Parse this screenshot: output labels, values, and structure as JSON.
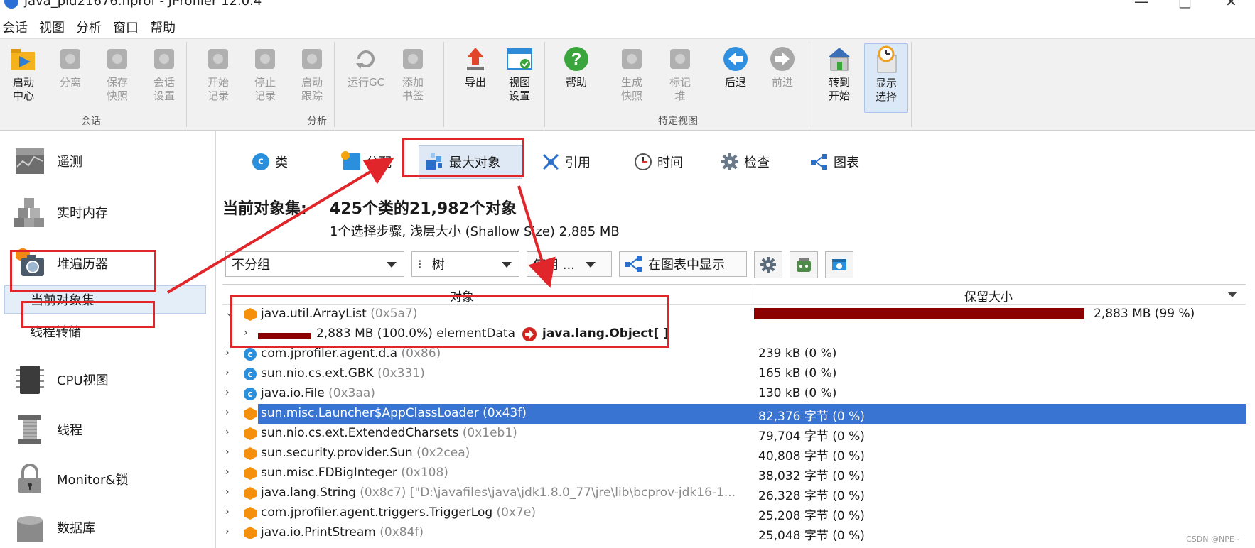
{
  "window": {
    "title": "java_pid21676.hprof - JProfiler 12.0.4"
  },
  "menu": [
    "会话",
    "视图",
    "分析",
    "窗口",
    "帮助"
  ],
  "toolbar": {
    "buttons": [
      {
        "line1": "启动",
        "line2": "中心",
        "icon": "session-start-icon",
        "enabled": true
      },
      {
        "line1": "分离",
        "line2": "",
        "icon": "detach-icon",
        "enabled": false
      },
      {
        "line1": "保存",
        "line2": "快照",
        "icon": "save-snapshot-icon",
        "enabled": false
      },
      {
        "line1": "会话",
        "line2": "设置",
        "icon": "session-settings-icon",
        "enabled": false
      },
      {
        "line1": "开始",
        "line2": "记录",
        "icon": "start-recording-icon",
        "enabled": false
      },
      {
        "line1": "停止",
        "line2": "记录",
        "icon": "stop-recording-icon",
        "enabled": false
      },
      {
        "line1": "启动",
        "line2": "跟踪",
        "icon": "start-tracking-icon",
        "enabled": false
      },
      {
        "line1": "运行GC",
        "line2": "",
        "icon": "run-gc-icon",
        "enabled": false
      },
      {
        "line1": "添加",
        "line2": "书签",
        "icon": "add-bookmark-icon",
        "enabled": false
      },
      {
        "line1": "导出",
        "line2": "",
        "icon": "export-icon",
        "enabled": true
      },
      {
        "line1": "视图",
        "line2": "设置",
        "icon": "view-settings-icon",
        "enabled": true
      },
      {
        "line1": "帮助",
        "line2": "",
        "icon": "help-icon",
        "enabled": true
      },
      {
        "line1": "生成",
        "line2": "快照",
        "icon": "take-snapshot-icon",
        "enabled": false
      },
      {
        "line1": "标记",
        "line2": "堆",
        "icon": "mark-heap-icon",
        "enabled": false
      },
      {
        "line1": "后退",
        "line2": "",
        "icon": "back-icon",
        "enabled": true
      },
      {
        "line1": "前进",
        "line2": "",
        "icon": "forward-icon",
        "enabled": false
      },
      {
        "line1": "转到",
        "line2": "开始",
        "icon": "go-home-icon",
        "enabled": true
      },
      {
        "line1": "显示",
        "line2": "选择",
        "icon": "show-selection-icon",
        "enabled": true
      }
    ],
    "groups": [
      "会话",
      "分析",
      "特定视图"
    ]
  },
  "sidebar": {
    "items": [
      {
        "label": "遥测",
        "icon": "telemetry-icon"
      },
      {
        "label": "实时内存",
        "icon": "live-memory-icon"
      },
      {
        "label": "堆遍历器",
        "icon": "heap-walker-icon"
      },
      {
        "label": "CPU视图",
        "icon": "cpu-views-icon"
      },
      {
        "label": "线程",
        "icon": "threads-icon"
      },
      {
        "label": "Monitor&锁",
        "icon": "monitor-lock-icon"
      },
      {
        "label": "数据库",
        "icon": "database-icon"
      }
    ],
    "subitems": [
      "当前对象集",
      "线程转储"
    ]
  },
  "tabs": [
    {
      "label": "类",
      "icon": "class-icon"
    },
    {
      "label": "分配",
      "icon": "allocation-icon"
    },
    {
      "label": "最大对象",
      "icon": "biggest-objects-icon"
    },
    {
      "label": "引用",
      "icon": "references-icon"
    },
    {
      "label": "时间",
      "icon": "time-icon"
    },
    {
      "label": "检查",
      "icon": "inspection-icon"
    },
    {
      "label": "图表",
      "icon": "graph-icon"
    }
  ],
  "current_set": {
    "label": "当前对象集:",
    "summary": "425个类的21,982个对象",
    "detail": "1个选择步骤, 浅层大小 (Shallow Size) 2,885 MB"
  },
  "controls": {
    "grouping": "不分组",
    "view_mode": "树",
    "use": "使用 ...",
    "show_in_graph": "在图表中显示"
  },
  "table": {
    "columns": [
      "对象",
      "保留大小"
    ],
    "rows": [
      {
        "name": "java.util.ArrayList",
        "addr": "(0x5a7)",
        "value": "2,883 MB (99 %)",
        "icon": "cube",
        "bar_fraction": 0.99
      },
      {
        "name": "com.jprofiler.agent.d.a",
        "addr": "(0x86)",
        "value": "239 kB (0 %)",
        "icon": "class"
      },
      {
        "name": "sun.nio.cs.ext.GBK",
        "addr": "(0x331)",
        "value": "165 kB (0 %)",
        "icon": "class"
      },
      {
        "name": "java.io.File",
        "addr": "(0x3aa)",
        "value": "130 kB (0 %)",
        "icon": "class"
      },
      {
        "name": "sun.misc.Launcher$AppClassLoader",
        "addr": "(0x43f)",
        "value": "82,376 字节 (0 %)",
        "icon": "cube",
        "selected": true
      },
      {
        "name": "sun.nio.cs.ext.ExtendedCharsets",
        "addr": "(0x1eb1)",
        "value": "79,704 字节 (0 %)",
        "icon": "cube"
      },
      {
        "name": "sun.security.provider.Sun",
        "addr": "(0x2cea)",
        "value": "40,808 字节 (0 %)",
        "icon": "cube"
      },
      {
        "name": "sun.misc.FDBigInteger",
        "addr": "(0x108)",
        "value": "38,032 字节 (0 %)",
        "icon": "cube"
      },
      {
        "name": "java.lang.String",
        "addr": "(0x8c7) [\"D:\\javafiles\\java\\jdk1.8.0_77\\jre\\lib\\bcprov-jdk16-1...",
        "value": "26,328 字节 (0 %)",
        "icon": "cube"
      },
      {
        "name": "com.jprofiler.agent.triggers.TriggerLog",
        "addr": "(0x7e)",
        "value": "25,208 字节 (0 %)",
        "icon": "cube"
      },
      {
        "name": "java.io.PrintStream",
        "addr": "(0x84f)",
        "value": "25,048 字节 (0 %)",
        "icon": "cube"
      }
    ],
    "child": {
      "size": "2,883 MB (100.0%) elementData",
      "type": "java.lang.Object[ ]"
    }
  },
  "watermark": "CSDN @NPE~",
  "colors": {
    "accent": "#3a74d3",
    "annotation": "#e0262b",
    "bar": "#8b0000"
  }
}
